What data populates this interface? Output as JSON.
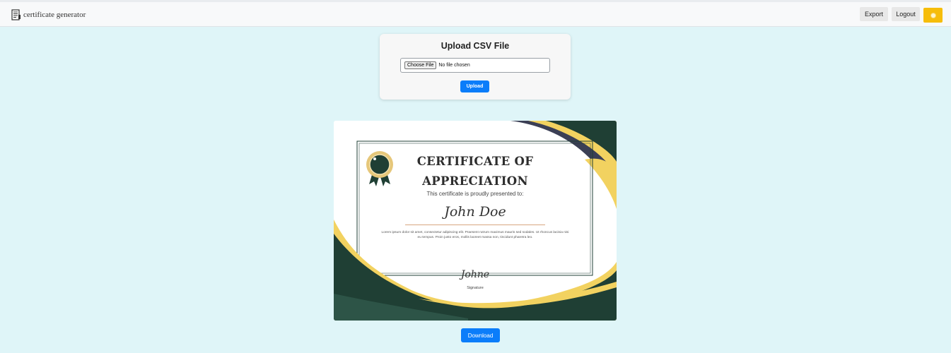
{
  "header": {
    "brand": "certificate generator",
    "export_label": "Export",
    "logout_label": "Logout",
    "theme_icon": "sun-icon"
  },
  "upload": {
    "title": "Upload CSV File",
    "choose_label": "Choose File",
    "file_status": "No file chosen",
    "button_label": "Upload"
  },
  "certificate": {
    "title_line1": "CERTIFICATE OF",
    "title_line2": "APPRECIATION",
    "subtitle": "This certificate is proudly presented to:",
    "recipient": "John Doe",
    "body": "Lorem ipsum dolor sit amet, consectetur adipiscing elit. Praesent rutrum maximus mauris sed sodales. Ut rhoncus lacinia nisi eu tempus. Proin justo eros, mollis laoreet massa non, tincidunt pharetra leo.",
    "signature": "Johne",
    "signature_label": "Signature",
    "colors": {
      "green": "#1f3f34",
      "gold": "#f2d260",
      "navy": "#3b3f55"
    }
  },
  "download_label": "Download",
  "colors": {
    "accent": "#0b7dfa",
    "background": "#dff5f8",
    "theme_button": "#f6bd0a"
  }
}
